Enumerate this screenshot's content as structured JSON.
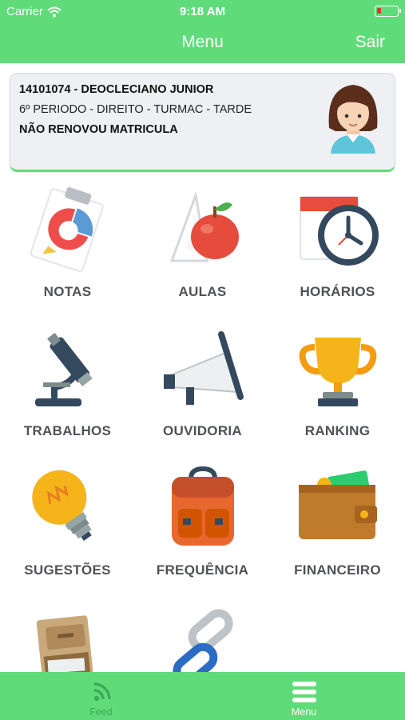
{
  "status_bar": {
    "carrier": "Carrier",
    "time": "9:18 AM"
  },
  "header": {
    "title": "Menu",
    "logout_label": "Sair"
  },
  "profile": {
    "line1": "14101074 - DEOCLECIANO JUNIOR",
    "line2": "6º PERIODO  - DIREITO - TURMAC - TARDE",
    "line3": "NÃO RENOVOU MATRICULA"
  },
  "menu": {
    "items": [
      {
        "label": "NOTAS",
        "icon": "clipboard-grades-icon"
      },
      {
        "label": "AULAS",
        "icon": "apple-ruler-icon"
      },
      {
        "label": "HORÁRIOS",
        "icon": "calendar-clock-icon"
      },
      {
        "label": "TRABALHOS",
        "icon": "microscope-icon"
      },
      {
        "label": "OUVIDORIA",
        "icon": "megaphone-icon"
      },
      {
        "label": "RANKING",
        "icon": "trophy-icon"
      },
      {
        "label": "SUGESTÕES",
        "icon": "lightbulb-icon"
      },
      {
        "label": "FREQUÊNCIA",
        "icon": "backpack-icon"
      },
      {
        "label": "FINANCEIRO",
        "icon": "wallet-icon"
      },
      {
        "label": "",
        "icon": "file-cabinet-icon"
      },
      {
        "label": "",
        "icon": "chain-link-icon"
      }
    ]
  },
  "tab_bar": {
    "feed_label": "Feed",
    "menu_label": "Menu",
    "active": "Menu"
  },
  "colors": {
    "accent": "#5fdc79",
    "text": "#4f5156"
  }
}
